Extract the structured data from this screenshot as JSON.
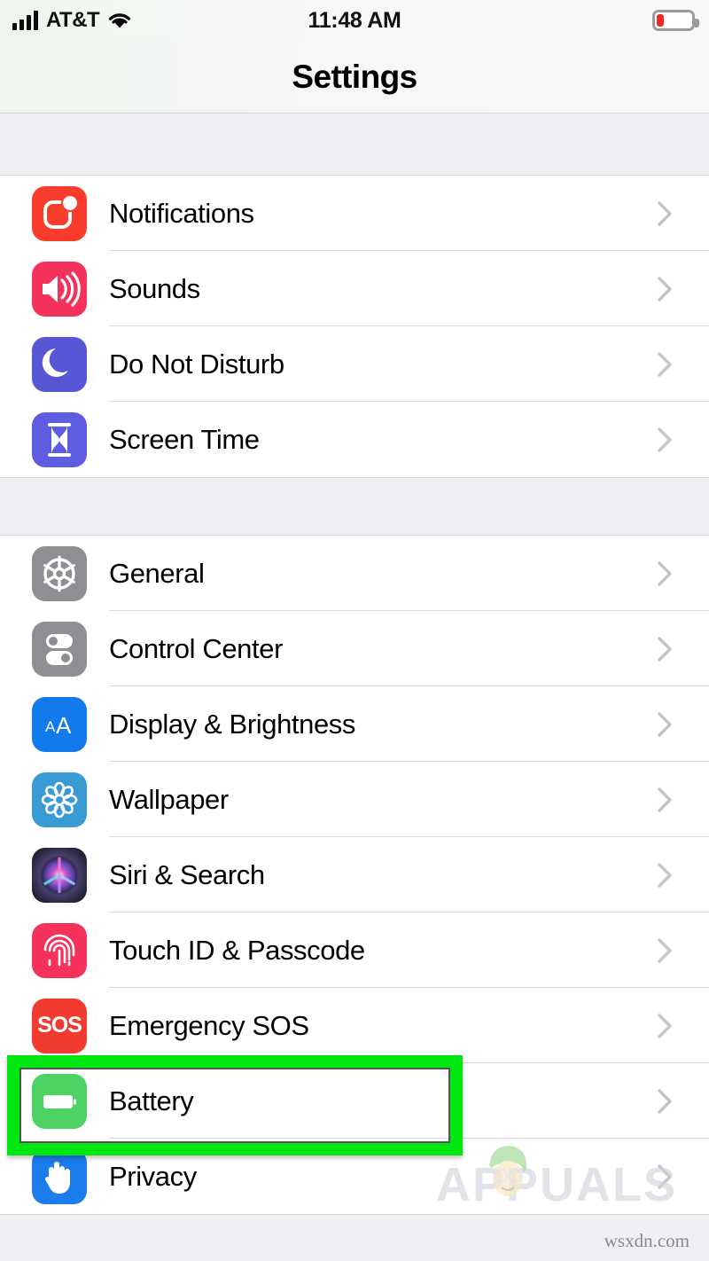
{
  "status_bar": {
    "carrier": "AT&T",
    "time": "11:48 AM",
    "signal_icon": "cellular-bars-icon",
    "wifi_icon": "wifi-icon",
    "battery_icon": "battery-low-icon",
    "battery_level_percent": 18,
    "battery_color": "#f02a22"
  },
  "header": {
    "title": "Settings"
  },
  "groups": [
    {
      "name": "notifications-group",
      "rows": [
        {
          "label": "Notifications",
          "icon": "notifications-icon",
          "color": "#fa3c2d",
          "chevron": "chevron-right-icon"
        },
        {
          "label": "Sounds",
          "icon": "sounds-icon",
          "color": "#f5325b",
          "chevron": "chevron-right-icon"
        },
        {
          "label": "Do Not Disturb",
          "icon": "do-not-disturb-icon",
          "color": "#5756d5",
          "chevron": "chevron-right-icon"
        },
        {
          "label": "Screen Time",
          "icon": "screen-time-icon",
          "color": "#5e5ce0",
          "chevron": "chevron-right-icon"
        }
      ]
    },
    {
      "name": "general-group",
      "rows": [
        {
          "label": "General",
          "icon": "gear-icon",
          "color": "#8e8e93",
          "chevron": "chevron-right-icon"
        },
        {
          "label": "Control Center",
          "icon": "control-center-icon",
          "color": "#8e8e93",
          "chevron": "chevron-right-icon"
        },
        {
          "label": "Display & Brightness",
          "icon": "display-icon",
          "color": "#127aeb",
          "chevron": "chevron-right-icon"
        },
        {
          "label": "Wallpaper",
          "icon": "wallpaper-icon",
          "color": "#3a9bd4",
          "chevron": "chevron-right-icon"
        },
        {
          "label": "Siri & Search",
          "icon": "siri-icon",
          "color": "#2b2b44",
          "chevron": "chevron-right-icon"
        },
        {
          "label": "Touch ID & Passcode",
          "icon": "touch-id-icon",
          "color": "#f5325b",
          "chevron": "chevron-right-icon"
        },
        {
          "label": "Emergency SOS",
          "icon": "emergency-sos-icon",
          "color": "#f23b30",
          "chevron": "chevron-right-icon"
        },
        {
          "label": "Battery",
          "icon": "battery-icon",
          "color": "#4cd364",
          "chevron": "chevron-right-icon"
        },
        {
          "label": "Privacy",
          "icon": "privacy-hand-icon",
          "color": "#1a7ced",
          "chevron": "chevron-right-icon"
        }
      ]
    }
  ],
  "annotation": {
    "name": "battery-row-highlight",
    "color": "#00e610",
    "target_label": "Battery"
  },
  "watermark": {
    "brand": "APPUALS",
    "site": "wsxdn.com"
  },
  "sos_label": "SOS"
}
